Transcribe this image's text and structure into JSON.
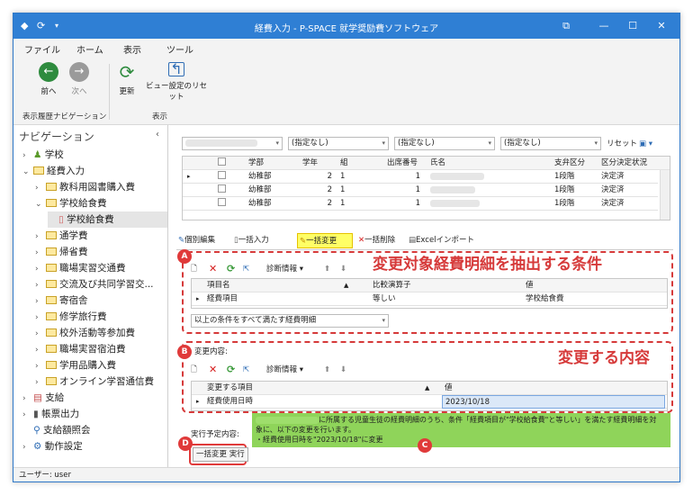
{
  "window": {
    "title": "経費入力 - P-SPACE 就学奨励費ソフトウェア"
  },
  "menu": [
    "ファイル",
    "ホーム",
    "表示",
    "ツール"
  ],
  "ribbon": {
    "back": "前へ",
    "forward": "次へ",
    "refresh": "更新",
    "view_reset": "ビュー設定のリセット",
    "group_nav": "表示履歴ナビゲーション",
    "group_view": "表示"
  },
  "nav": {
    "title": "ナビゲーション",
    "items": [
      "学校",
      "経費入力",
      "教科用図書購入費",
      "学校給食費",
      "学校給食費",
      "通学費",
      "帰省費",
      "職場実習交通費",
      "交流及び共同学習交...",
      "寄宿舎",
      "修学旅行費",
      "校外活動等参加費",
      "職場実習宿泊費",
      "学用品購入費",
      "オンライン学習通信費",
      "支給",
      "帳票出力",
      "支給額照会",
      "動作設定"
    ]
  },
  "filters": {
    "f1": "(指定なし)",
    "f2": "(指定なし)",
    "f3": "(指定なし)",
    "reset": "リセット"
  },
  "grid": {
    "headers": [
      "学部",
      "学年",
      "組",
      "出席番号",
      "氏名",
      "支弁区分",
      "区分決定状況"
    ],
    "rows": [
      [
        "幼稚部",
        "2",
        "1",
        "1",
        "1段階",
        "決定済"
      ],
      [
        "幼稚部",
        "2",
        "1",
        "1",
        "1段階",
        "決定済"
      ],
      [
        "幼稚部",
        "2",
        "1",
        "1",
        "1段階",
        "決定済"
      ]
    ]
  },
  "tabs": [
    "個別編集",
    "一括入力",
    "一括変更",
    "一括削除",
    "Excelインポート"
  ],
  "conditions": {
    "diag": "診断情報",
    "headers": [
      "項目名",
      "比較演算子",
      "値"
    ],
    "row": [
      "経費項目",
      "等しい",
      "学校給食費"
    ],
    "combo": "以上の条件をすべて満たす経費明細"
  },
  "changes": {
    "label": "変更内容:",
    "diag": "診断情報",
    "headers": [
      "変更する項目",
      "値"
    ],
    "row": [
      "経費使用日時",
      "2023/10/18"
    ]
  },
  "exec": {
    "label": "実行予定内容:",
    "line1": "に所属する児童生徒の経費明細のうち、条件「経費項目が\"学校給食費\"と等しい」を満たす経費明細を対",
    "line2": "象に、以下の変更を行います。",
    "line3": "・経費使用日時を\"2023/10/18\"に変更",
    "button": "一括変更 実行"
  },
  "annotations": {
    "a": "A",
    "b": "B",
    "c": "C",
    "d": "D",
    "callout_a": "変更対象経費明細を抽出する条件",
    "callout_b": "変更する内容"
  },
  "status": "ユーザー: user"
}
